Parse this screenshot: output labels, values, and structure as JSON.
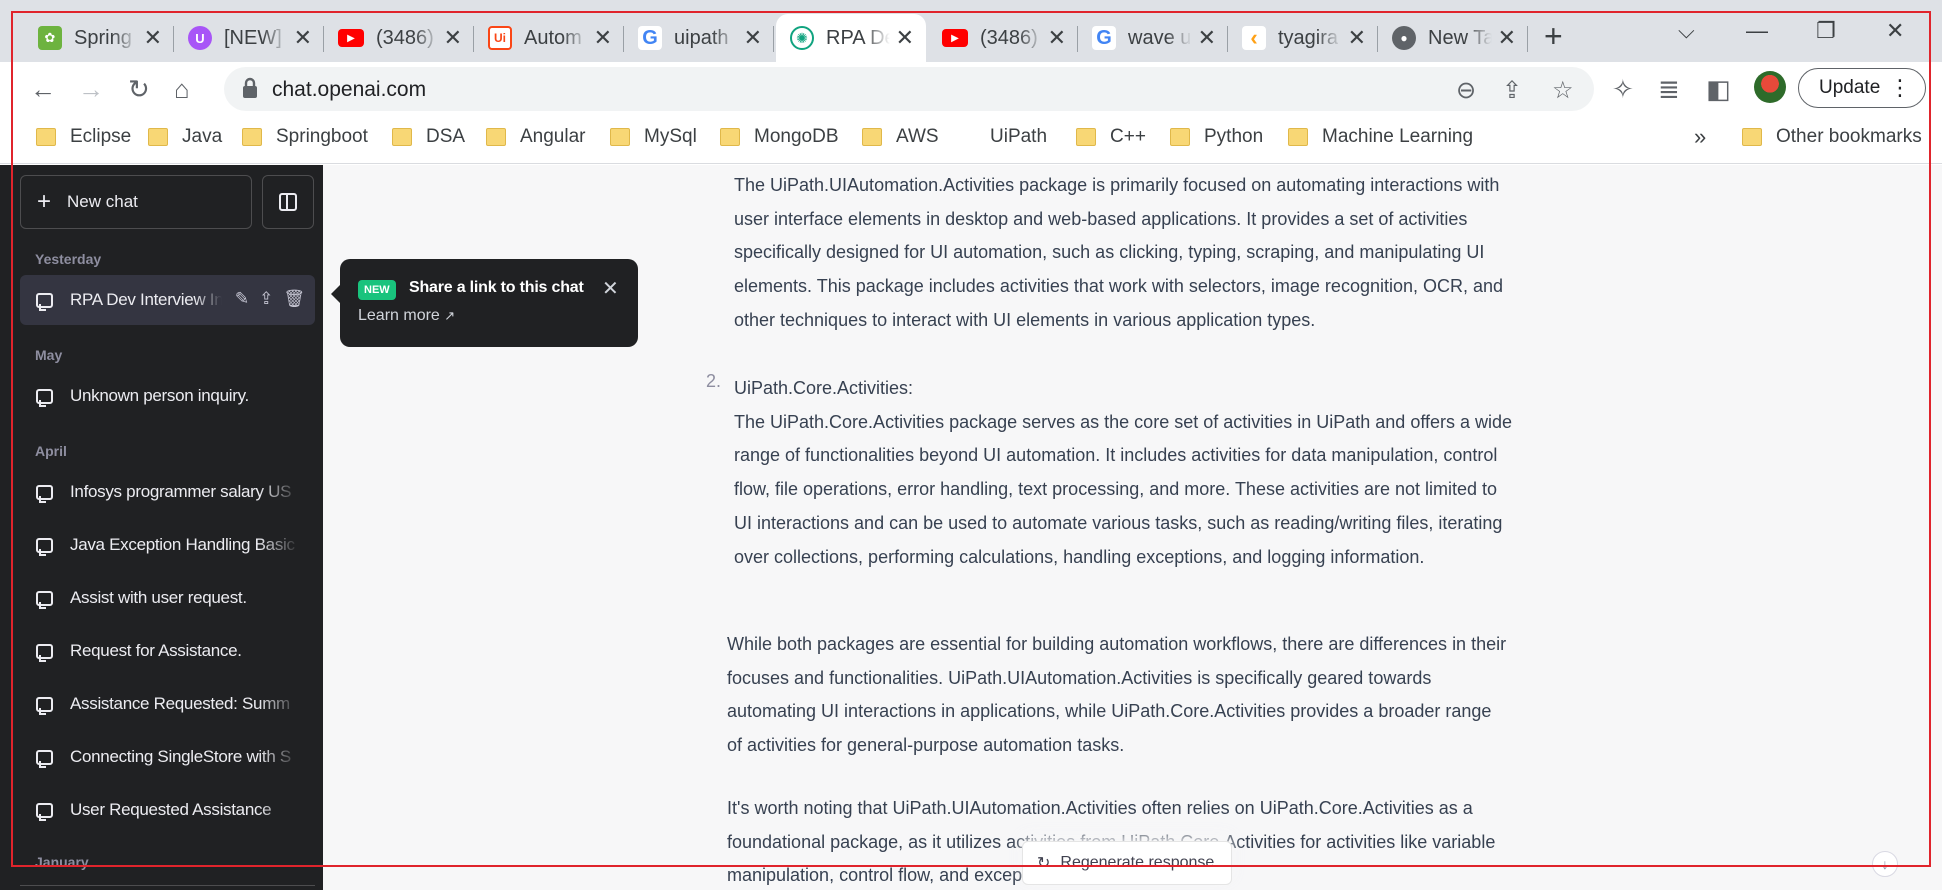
{
  "browser": {
    "tabs": [
      {
        "title": "Spring",
        "icon": "spring-leaf-icon",
        "color": "#6db33f"
      },
      {
        "title": "[NEW]",
        "icon": "uipath-forum-icon",
        "color": "#a855f7"
      },
      {
        "title": "(3486)",
        "icon": "youtube-icon",
        "color": "#ff0000"
      },
      {
        "title": "Autom",
        "icon": "uipath-logo-icon",
        "color": "#fa4616"
      },
      {
        "title": "uipath",
        "icon": "google-icon",
        "color": "#4285f4"
      },
      {
        "title": "RPA De",
        "icon": "openai-icon",
        "color": "#10a37f"
      },
      {
        "title": "(3486)",
        "icon": "youtube-icon",
        "color": "#ff0000"
      },
      {
        "title": "wave u",
        "icon": "google-icon",
        "color": "#4285f4"
      },
      {
        "title": "tyagira",
        "icon": "leetcode-icon",
        "color": "#ffa116"
      },
      {
        "title": "New Ta",
        "icon": "chrome-icon",
        "color": "#5f6368"
      }
    ],
    "url": "chat.openai.com",
    "update_label": "Update",
    "bookmarks": [
      "Eclipse",
      "Java",
      "Springboot",
      "DSA",
      "Angular",
      "MySql",
      "MongoDB",
      "AWS",
      "UiPath",
      "C++",
      "Python",
      "Machine Learning"
    ],
    "overflow_chevron": "»",
    "other_bookmarks": "Other bookmarks"
  },
  "sidebar": {
    "new_chat_label": "New chat",
    "sections": {
      "yesterday": "Yesterday",
      "may": "May",
      "april": "April",
      "january": "January"
    },
    "items": [
      {
        "label": "RPA Dev Interview In",
        "selected": true
      },
      {
        "label": "Unknown person inquiry."
      },
      {
        "label": "Infosys programmer salary US"
      },
      {
        "label": "Java Exception Handling Basic"
      },
      {
        "label": "Assist with user request."
      },
      {
        "label": "Request for Assistance."
      },
      {
        "label": "Assistance Requested: Summ"
      },
      {
        "label": "Connecting SingleStore with S"
      },
      {
        "label": "User Requested Assistance"
      }
    ]
  },
  "popover": {
    "badge": "NEW",
    "title": "Share a link to this chat",
    "link": "Learn more"
  },
  "conversation": {
    "li1_text": "The UiPath.UIAutomation.Activities package is primarily focused on automating interactions with user interface elements in desktop and web-based applications. It provides a set of activities specifically designed for UI automation, such as clicking, typing, scraping, and manipulating UI elements. This package includes activities that work with selectors, image recognition, OCR, and other techniques to interact with UI elements in various application types.",
    "li2_number": "2.",
    "li2_heading": "UiPath.Core.Activities:",
    "li2_text": "The UiPath.Core.Activities package serves as the core set of activities in UiPath and offers a wide range of functionalities beyond UI automation. It includes activities for data manipulation, control flow, file operations, error handling, text processing, and more. These activities are not limited to UI interactions and can be used to automate various tasks, such as reading/writing files, iterating over collections, performing calculations, handling exceptions, and logging information.",
    "para1": "While both packages are essential for building automation workflows, there are differences in their focuses and functionalities. UiPath.UIAutomation.Activities is specifically geared towards automating UI interactions in applications, while UiPath.Core.Activities provides a broader range of activities for general-purpose automation tasks.",
    "para2": "It's worth noting that UiPath.UIAutomation.Activities often relies on UiPath.Core.Activities as a foundational package, as it utilizes activities from UiPath.Core.Activities for activities like variable manipulation, control flow, and exception handling."
  },
  "regenerate_label": "Regenerate response",
  "colors": {
    "sidebar_bg": "#202123",
    "sidebar_selected": "#343541",
    "new_badge": "#19c37d",
    "annotation_box": "#e0242c"
  }
}
